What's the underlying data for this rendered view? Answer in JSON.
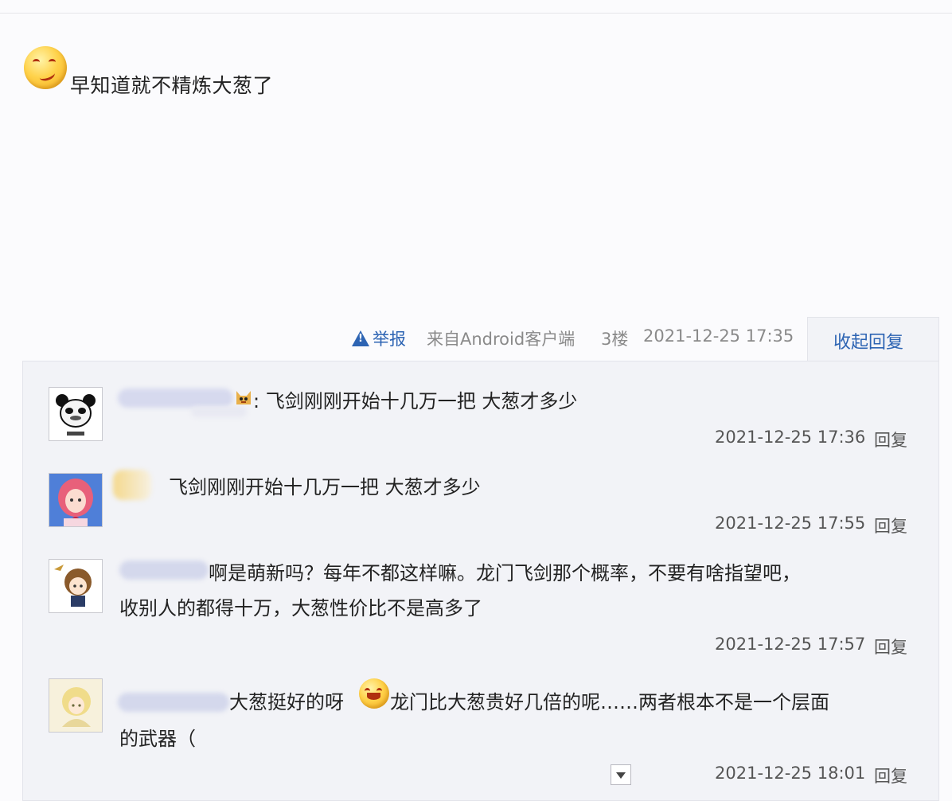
{
  "post": {
    "text": "早知道就不精炼大葱了",
    "emoji": "smirk-face-emoji"
  },
  "meta": {
    "report_label": "举报",
    "source": "来自Android客户端",
    "floor": "3楼",
    "time": "2021-12-25 17:35",
    "collapse_label": "收起回复"
  },
  "replies": [
    {
      "avatar": "panda-meme-avatar",
      "name_hidden": true,
      "emoji": "cat-emoji",
      "text": ": 飞剑刚刚开始十几万一把 大葱才多少",
      "time": "2021-12-25 17:36",
      "reply_label": "回复"
    },
    {
      "avatar": "pink-hair-girl-avatar",
      "name_hidden": true,
      "text": "飞剑刚刚开始十几万一把 大葱才多少",
      "time": "2021-12-25 17:55",
      "reply_label": "回复"
    },
    {
      "avatar": "anime-boy-avatar",
      "name_hidden": true,
      "text_line1": "啊是萌新吗？每年不都这样嘛。龙门飞剑那个概率，不要有啥指望吧，",
      "text_line2": "收别人的都得十万，大葱性价比不是高多了",
      "time": "2021-12-25 17:57",
      "reply_label": "回复"
    },
    {
      "avatar": "blonde-character-avatar",
      "name_hidden": true,
      "emoji": "laugh-cry-emoji",
      "text_a": "大葱挺好的呀",
      "text_b": "龙门比大葱贵好几倍的呢……两者根本不是一个层面",
      "text_line2": "的武器（",
      "time": "2021-12-25 18:01",
      "reply_label": "回复"
    }
  ],
  "colors": {
    "link": "#2d64b3",
    "reply_bg": "#f2f3f7",
    "page_bg": "#fbfbfd"
  }
}
